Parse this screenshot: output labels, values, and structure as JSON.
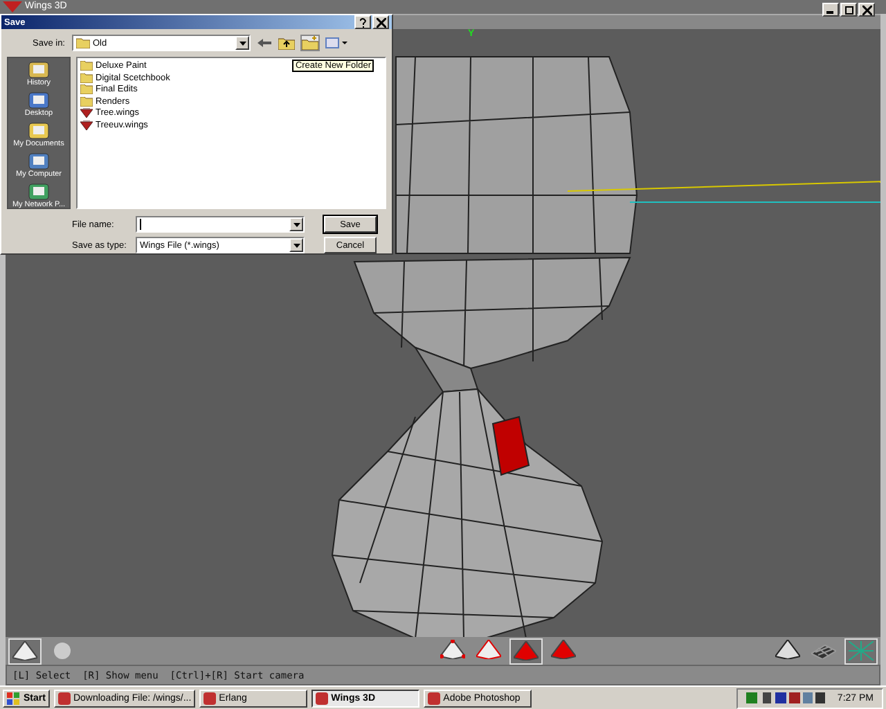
{
  "window": {
    "title": "Wings 3D"
  },
  "dialog": {
    "title": "Save",
    "save_in_label": "Save in:",
    "folder": "Old",
    "tooltip": "Create New Folder",
    "places": [
      {
        "label": "History",
        "kind": "history"
      },
      {
        "label": "Desktop",
        "kind": "desktop"
      },
      {
        "label": "My Documents",
        "kind": "documents"
      },
      {
        "label": "My Computer",
        "kind": "computer"
      },
      {
        "label": "My Network P...",
        "kind": "network"
      }
    ],
    "files": [
      {
        "name": "Deluxe Paint",
        "kind": "folder"
      },
      {
        "name": "Digital Scetchbook",
        "kind": "folder"
      },
      {
        "name": "Final Edits",
        "kind": "folder"
      },
      {
        "name": "Renders",
        "kind": "folder"
      },
      {
        "name": "Tree.wings",
        "kind": "wings"
      },
      {
        "name": "Treeuv.wings",
        "kind": "wings"
      }
    ],
    "file_name_label": "File name:",
    "save_as_type_label": "Save as type:",
    "save_as_type": "Wings File (*.wings)",
    "buttons": [
      "Save",
      "Cancel"
    ]
  },
  "viewport": {
    "axis_label": "Y"
  },
  "toolbar": {
    "left": [
      {
        "kind": "pyramid",
        "selected": true
      },
      {
        "kind": "smooth",
        "selected": false
      }
    ],
    "modes": [
      {
        "kind": "vertex",
        "selected": false
      },
      {
        "kind": "edge",
        "selected": false
      },
      {
        "kind": "face",
        "selected": true
      },
      {
        "kind": "body",
        "selected": false
      }
    ],
    "right": [
      {
        "kind": "pyramid",
        "selected": false
      },
      {
        "kind": "grid",
        "selected": false
      },
      {
        "kind": "axes",
        "selected": true
      }
    ]
  },
  "status_bar": "[L] Select  [R] Show menu  [Ctrl]+[R] Start camera",
  "taskbar": {
    "start": "Start",
    "tasks": [
      {
        "label": "Downloading File: /wings/...",
        "selected": false
      },
      {
        "label": "Erlang",
        "selected": false
      },
      {
        "label": "Wings 3D",
        "selected": true
      },
      {
        "label": "Adobe Photoshop",
        "selected": false
      }
    ],
    "clock": "7:27 PM"
  }
}
